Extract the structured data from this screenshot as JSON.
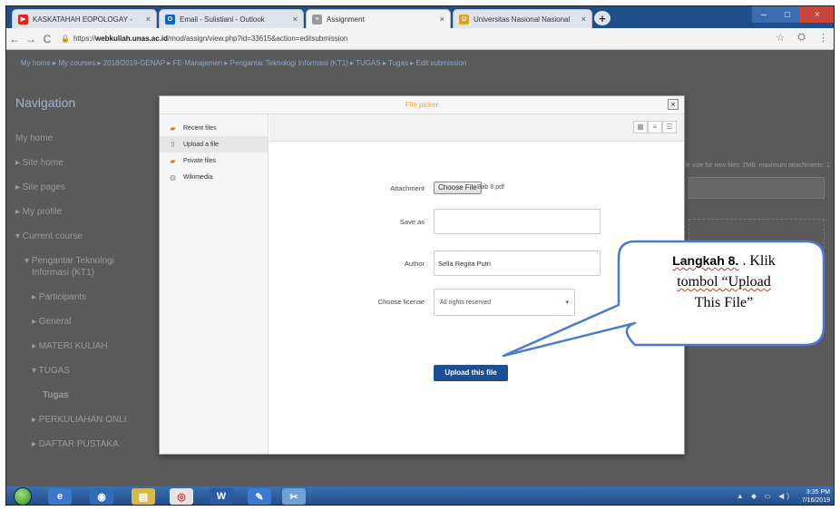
{
  "browser": {
    "tabs": [
      {
        "label": "KASKATAHAH EOPOLOGAY -"
      },
      {
        "label": "Email - Sulistiani - Outlook"
      },
      {
        "label": "Assignment"
      },
      {
        "label": "Universitas Nasional Nasional"
      }
    ],
    "url_prefix": "https://",
    "url_domain": "webkuliah.unas.ac.id",
    "url_path": "/mod/assign/view.php?id=33615&action=editsubmission"
  },
  "breadcrumb": "My home ▸ My courses ▸ 2018/2019-GENAP ▸ FE-Manajemen ▸ Pengantar Teknologi Informasi (KT1) ▸ TUGAS ▸ Tugas ▸ Edit submission",
  "nav": {
    "title": "Navigation",
    "items": [
      "My home",
      "▸ Site home",
      "▸ Site pages",
      "▸ My profile",
      "▾ Current course",
      "▾ Pengantar Teknologi",
      "Informasi (KT1)",
      "▸ Participants",
      "▸ General",
      "▸ MATERI KULIAH",
      "▾ TUGAS",
      "Tugas",
      "▸ PERKULIAHAN ONLI",
      "▸ DAFTAR PUSTAKA"
    ]
  },
  "background_note": "ile size for new files: 2MB, maximum attachments: 1",
  "file_picker": {
    "title": "File picker",
    "close": "×",
    "sidebar": [
      "Recent files",
      "Upload a file",
      "Private files",
      "Wikimedia"
    ],
    "labels": {
      "attachment": "Attachment",
      "save_as": "Save as",
      "author": "Author",
      "license": "Choose license"
    },
    "choose_button": "Choose File",
    "chosen_file": "Bab 8.pdf",
    "save_as_value": "",
    "author_value": "Sella Regita Putri",
    "license_value": "All rights reserved",
    "upload_button": "Upload this file"
  },
  "callout": {
    "line1_bold": "Langkah 8.",
    "line1_rest": " . Klik",
    "line2": "tombol “Upload",
    "line3": "This File”",
    "border_color": "#4a7bd0"
  },
  "taskbar": {
    "time": "3:35 PM",
    "date": "7/16/2019"
  }
}
